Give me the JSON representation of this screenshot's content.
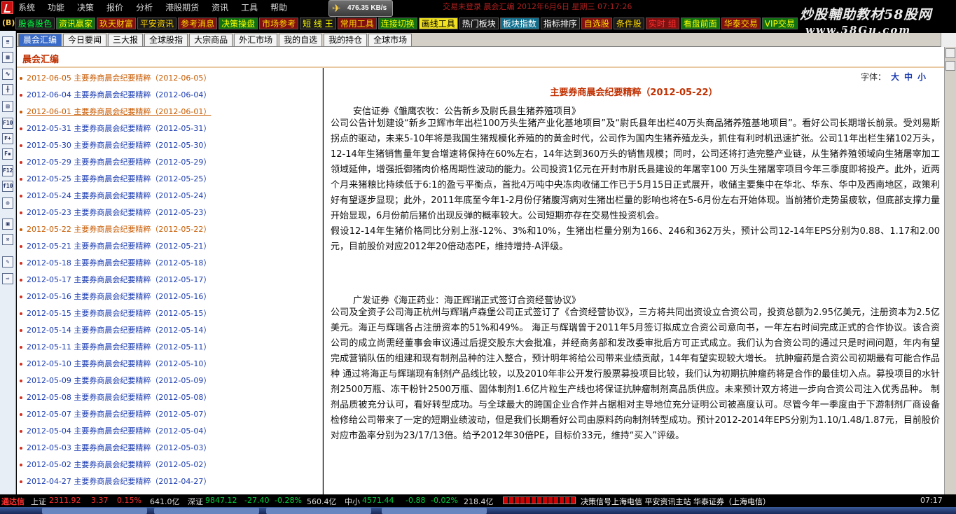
{
  "menu": {
    "items": [
      "系统",
      "功能",
      "决策",
      "报价",
      "分析",
      "港股期货",
      "资讯",
      "工具",
      "帮助"
    ],
    "speed": "476.35 KB/s",
    "title_strip": "交易未登录  晨会汇编  2012年6月6日 星期三 07:17:26"
  },
  "watermark": {
    "line1": "炒股輔助教材58股网",
    "line2": "www.58Gu.com"
  },
  "toolbar": {
    "b_label": "(B)",
    "buttons": [
      {
        "label": "股香股色",
        "fg": "#00ff40",
        "bg": "#1a1a1a"
      },
      {
        "label": "资讯赢家",
        "fg": "#ffff00",
        "bg": "#107010"
      },
      {
        "label": "玖天财富",
        "fg": "#ffd800",
        "bg": "#801010"
      },
      {
        "label": "平安资讯",
        "fg": "#ffd800",
        "bg": "#1a1a1a"
      },
      {
        "label": "参考消息",
        "fg": "#ffd800",
        "bg": "#801010"
      },
      {
        "label": "决策操盘",
        "fg": "#ffff00",
        "bg": "#107010"
      },
      {
        "label": "市场参考",
        "fg": "#ffd800",
        "bg": "#801010"
      },
      {
        "label": "短  线  王",
        "fg": "#ffff00",
        "bg": "#1a1a1a"
      },
      {
        "label": "常用工具",
        "fg": "#ffd800",
        "bg": "#801010"
      },
      {
        "label": "连接切换",
        "fg": "#ffff00",
        "bg": "#107010"
      },
      {
        "label": "画线工具",
        "fg": "#000000",
        "bg": "#f0e020"
      },
      {
        "label": "热门板块",
        "fg": "#ffffff",
        "bg": "#1a1a1a"
      },
      {
        "label": "板块指数",
        "fg": "#ffffff",
        "bg": "#107090"
      },
      {
        "label": "指标排序",
        "fg": "#ffffff",
        "bg": "#1a1a1a"
      },
      {
        "label": "自选股",
        "fg": "#ffd800",
        "bg": "#801010"
      },
      {
        "label": "条件股",
        "fg": "#ffd800",
        "bg": "#1a1a1a"
      },
      {
        "label": "实时 组",
        "fg": "#ff3030",
        "bg": "#801010"
      },
      {
        "label": "看盘前面",
        "fg": "#ffff00",
        "bg": "#107010"
      },
      {
        "label": "华泰交易",
        "fg": "#ffd800",
        "bg": "#801010"
      },
      {
        "label": "VIP交易",
        "fg": "#ffff00",
        "bg": "#107010"
      }
    ]
  },
  "left_strip": {
    "icons": [
      "list-icon",
      "table-icon",
      "line-chart-icon",
      "candle-icon",
      "report-icon",
      "f10-icon",
      "f10-plus-icon",
      "f10-doc-icon",
      "f12-icon",
      "f10-alt-icon",
      "search-icon",
      "grid-icon",
      "tools-icon",
      "pencil-icon",
      "exit-icon"
    ]
  },
  "tabs": [
    "晨会汇编",
    "今日要闻",
    "三大报",
    "全球股指",
    "大宗商品",
    "外汇市场",
    "我的自选",
    "我的持仓",
    "全球市场"
  ],
  "section_title": "晨会汇编",
  "list": [
    {
      "text": "2012-06-05  主要券商晨会纪要精粹（2012-06-05）",
      "state": "hl"
    },
    {
      "text": "2012-06-04  主要券商晨会纪要精粹（2012-06-04）",
      "state": ""
    },
    {
      "text": "2012-06-01  主要券商晨会纪要精粹（2012-06-01）",
      "state": "active"
    },
    {
      "text": "2012-05-31  主要券商晨会纪要精粹（2012-05-31）",
      "state": ""
    },
    {
      "text": "2012-05-30  主要券商晨会纪要精粹（2012-05-30）",
      "state": ""
    },
    {
      "text": "2012-05-29  主要券商晨会纪要精粹（2012-05-29）",
      "state": ""
    },
    {
      "text": "2012-05-25  主要券商晨会纪要精粹（2012-05-25）",
      "state": ""
    },
    {
      "text": "2012-05-24  主要券商晨会纪要精粹（2012-05-24）",
      "state": ""
    },
    {
      "text": "2012-05-23  主要券商晨会纪要精粹（2012-05-23）",
      "state": ""
    },
    {
      "text": "2012-05-22  主要券商晨会纪要精粹（2012-05-22）",
      "state": "hl"
    },
    {
      "text": "2012-05-21  主要券商晨会纪要精粹（2012-05-21）",
      "state": ""
    },
    {
      "text": "2012-05-18  主要券商晨会纪要精粹（2012-05-18）",
      "state": ""
    },
    {
      "text": "2012-05-17  主要券商晨会纪要精粹（2012-05-17）",
      "state": ""
    },
    {
      "text": "2012-05-16  主要券商晨会纪要精粹（2012-05-16）",
      "state": ""
    },
    {
      "text": "2012-05-15  主要券商晨会纪要精粹（2012-05-15）",
      "state": ""
    },
    {
      "text": "2012-05-14  主要券商晨会纪要精粹（2012-05-14）",
      "state": ""
    },
    {
      "text": "2012-05-11  主要券商晨会纪要精粹（2012-05-11）",
      "state": ""
    },
    {
      "text": "2012-05-10  主要券商晨会纪要精粹（2012-05-10）",
      "state": ""
    },
    {
      "text": "2012-05-09  主要券商晨会纪要精粹（2012-05-09）",
      "state": ""
    },
    {
      "text": "2012-05-08  主要券商晨会纪要精粹（2012-05-08）",
      "state": ""
    },
    {
      "text": "2012-05-07  主要券商晨会纪要精粹（2012-05-07）",
      "state": ""
    },
    {
      "text": "2012-05-04  主要券商晨会纪要精粹（2012-05-04）",
      "state": ""
    },
    {
      "text": "2012-05-03  主要券商晨会纪要精粹（2012-05-03）",
      "state": ""
    },
    {
      "text": "2012-05-02  主要券商晨会纪要精粹（2012-05-02）",
      "state": ""
    },
    {
      "text": "2012-04-27  主要券商晨会纪要精粹（2012-04-27）",
      "state": ""
    }
  ],
  "content": {
    "font_label": "字体：",
    "font_sizes": [
      "大",
      "中",
      "小"
    ],
    "title": "主要券商晨会纪要精粹（2012-05-22）",
    "reports": [
      {
        "head": "安信证券《雏鹰农牧：公告新乡及尉氏县生猪养殖项目》",
        "body": "公司公告计划建设“新乡卫辉市年出栏100万头生猪产业化基地项目”及“尉氏县年出栏40万头商品猪养殖基地项目”。看好公司长期增长前景。受刘易斯拐点的驱动，未来5-10年将是我国生猪规模化养殖的的黄金时代，公司作为国内生猪养殖龙头，抓住有利时机迅速扩张。公司11年出栏生猪102万头，12-14年生猪销售量年复合增速将保持在60%左右，14年达到360万头的销售规模；同时，公司还将打造完整产业链，从生猪养殖领域向生猪屠宰加工领域延伸，增强抵御猪肉价格周期性波动的能力。公司投资1亿元在开封市尉氏县建设的年屠宰100 万头生猪屠宰项目今年三季度即将投产。此外，近两个月来猪粮比持续低于6:1的盈亏平衡点，首批4万吨中央冻肉收储工作已于5月15日正式展开，收储主要集中在华北、华东、华中及西南地区，政策利好有望逐步显现；此外，2011年底至今年1-2月份仔猪腹泻病对生猪出栏量的影响也将在5-6月份左右开始体现。当前猪价走势虽疲软，但底部支撑力量开始显现，6月份前后猪价出现反弹的概率较大。公司短期亦存在交易性投资机会。\n假设12-14年生猪价格同比分别上涨-12%、3%和10%，生猪出栏量分别为166、246和362万头，预计公司12-14年EPS分别为0.88、1.17和2.00元，目前股价对应2012年20倍动态PE，维持增持-A评级。"
      },
      {
        "head": "广发证券《海正药业：海正辉瑞正式签订合资经营协议》",
        "body": "公司及全资子公司海正杭州与辉瑞卢森堡公司正式签订了《合资经营协议》，三方将共同出资设立合资公司，投资总额为2.95亿美元，注册资本为2.5亿美元。海正与辉瑞各占注册资本的51%和49%。 海正与辉瑞曾于2011年5月签订拟成立合资公司意向书，一年左右时间完成正式的合作协议。该合资公司的成立尚需经董事会审议通过后提交股东大会批准，并经商务部和发改委审批后方可正式成立。我们认为合资公司的通过只是时间问题，年内有望完成营销队伍的组建和现有制剂品种的注入整合，预计明年将给公司带来业绩贡献，14年有望实现较大增长。 抗肿瘤药是合资公司初期最有可能合作品种 通过将海正与辉瑞现有制剂产品线比较，以及2010年非公开发行股票募投项目比较，我们认为初期抗肿瘤药将是合作的最佳切入点。募投项目的水针剂2500万瓶、冻干粉针2500万瓶、固体制剂1.6亿片粒生产线也将保证抗肿瘤制剂高品质供应。未来预计双方将进一步向合资公司注入优秀品种。 制剂品质被充分认可，看好转型成功。与全球最大的跨国企业合作并占据相对主导地位充分证明公司被高度认可。尽管今年一季度由于下游制剂厂商设备检修给公司带来了一定的短期业绩波动，但是我们长期看好公司由原料药向制剂转型成功。预计2012-2014年EPS分别为1.10/1.48/1.87元，目前股价对应市盈率分别为23/17/13倍。给予2012年30倍PE，目标价33元，维持“买入”评级。"
      }
    ]
  },
  "statusbar": {
    "brand": "通达信",
    "sh_label": "上证",
    "sh_value": "2311.92",
    "sh_change": "3.37",
    "sh_pct": "0.15%",
    "sh_amount": "641.0亿",
    "sz_label": "深证",
    "sz_value": "9847.12",
    "sz_change": "-27.40",
    "sz_pct": "-0.28%",
    "sz_amount": "560.4亿",
    "zx_label": "中小",
    "zx_value": "4571.44",
    "zx_change": "-0.88",
    "zx_pct": "-0.02%",
    "zx_amount": "218.4亿",
    "info": "决策信号上海电信  平安资讯主站  华泰证券（上海电信）",
    "time": "07:17"
  },
  "colors": {
    "up": "#ff3030",
    "down": "#00d040",
    "link": "#1a3bb0",
    "highlight": "#c85a00",
    "title_red": "#c03000"
  }
}
